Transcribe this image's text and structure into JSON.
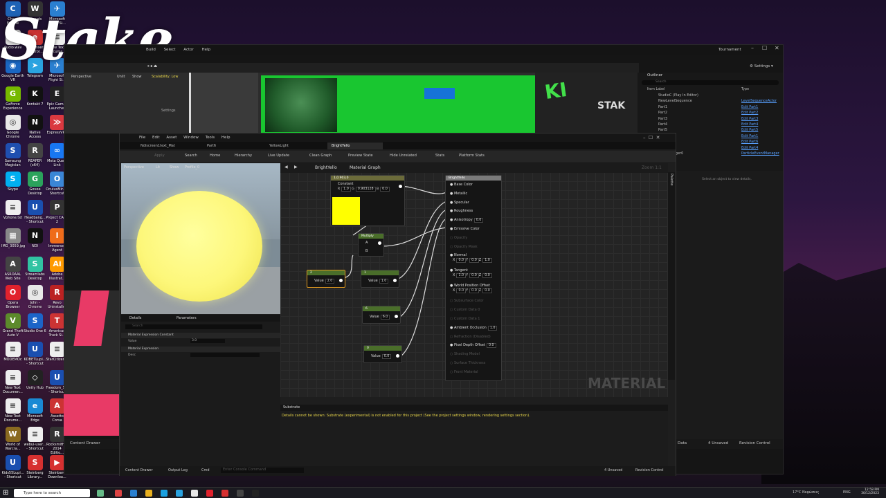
{
  "desktop": {
    "icons": [
      {
        "label": "Cheat Engine",
        "color": "#1e63b5",
        "glyph": "C"
      },
      {
        "label": "Wizards",
        "color": "#333",
        "glyph": "W"
      },
      {
        "label": "Microsoft Flight Si...",
        "color": "#2a7fd0",
        "glyph": "✈"
      },
      {
        "label": "Audio.wav",
        "color": "#ddd",
        "glyph": "▶"
      },
      {
        "label": "eLicenser Control...",
        "color": "#c33",
        "glyph": "e"
      },
      {
        "label": "New Text Docume...",
        "color": "#eee",
        "glyph": "≡"
      },
      {
        "label": "Google Earth VR",
        "color": "#1a66c2",
        "glyph": "◉"
      },
      {
        "label": "Telegram",
        "color": "#2aa3e0",
        "glyph": "➤"
      },
      {
        "label": "Microsoft Flight Si...",
        "color": "#2a7fd0",
        "glyph": "✈"
      },
      {
        "label": "GeForce Experience",
        "color": "#76b900",
        "glyph": "G"
      },
      {
        "label": "Kontakt 7",
        "color": "#111",
        "glyph": "K"
      },
      {
        "label": "Epic Games Launcher",
        "color": "#222",
        "glyph": "E"
      },
      {
        "label": "Google Chrome",
        "color": "#e8e8e8",
        "glyph": "◎"
      },
      {
        "label": "Native Access",
        "color": "#111",
        "glyph": "N"
      },
      {
        "label": "ExpressVPN",
        "color": "#da3940",
        "glyph": "≫"
      },
      {
        "label": "Samsung Magician",
        "color": "#1f4fb0",
        "glyph": "S"
      },
      {
        "label": "REAPER (x64)",
        "color": "#444",
        "glyph": "R"
      },
      {
        "label": "Meta Quest Link",
        "color": "#1877f2",
        "glyph": "∞"
      },
      {
        "label": "Skype",
        "color": "#00aff0",
        "glyph": "S"
      },
      {
        "label": "Govee Desktop",
        "color": "#2ba35c",
        "glyph": "G"
      },
      {
        "label": "OculusMir... - Shortcut",
        "color": "#3a86d6",
        "glyph": "O"
      },
      {
        "label": "Vphone.txt",
        "color": "#eee",
        "glyph": "≡"
      },
      {
        "label": "Headbang... - Shortcut",
        "color": "#1a4fb0",
        "glyph": "U"
      },
      {
        "label": "Project CARS 2",
        "color": "#333",
        "glyph": "P"
      },
      {
        "label": "IMG_3059.jpg",
        "color": "#888",
        "glyph": "▦"
      },
      {
        "label": "NDI",
        "color": "#111",
        "glyph": "N"
      },
      {
        "label": "Immersed Agent",
        "color": "#ef6c1a",
        "glyph": "I"
      },
      {
        "label": "ASROAAL Web Site",
        "color": "#444",
        "glyph": "A"
      },
      {
        "label": "Streamlabs Desktop",
        "color": "#31c3a2",
        "glyph": "S"
      },
      {
        "label": "Adobe Illustrat...",
        "color": "#ff9a00",
        "glyph": "Ai"
      },
      {
        "label": "Opera Browser",
        "color": "#e1222d",
        "glyph": "O"
      },
      {
        "label": "John - Chrome",
        "color": "#e8e8e8",
        "glyph": "◎"
      },
      {
        "label": "Revo Uninstaller",
        "color": "#b22",
        "glyph": "R"
      },
      {
        "label": "Grand Theft Auto V",
        "color": "#5c8a2b",
        "glyph": "V"
      },
      {
        "label": "Studio One 6",
        "color": "#1c64c8",
        "glyph": "S"
      },
      {
        "label": "American Truck Si...",
        "color": "#c33",
        "glyph": "T"
      },
      {
        "label": "MODEMOc",
        "color": "#eee",
        "glyph": "≡"
      },
      {
        "label": "KDBETLupi... - Shortcut",
        "color": "#1a4fb0",
        "glyph": "U"
      },
      {
        "label": "StarCitizen...",
        "color": "#eee",
        "glyph": "≡"
      },
      {
        "label": "New Text Documen...",
        "color": "#eee",
        "glyph": "≡"
      },
      {
        "label": "Unity Hub",
        "color": "#222",
        "glyph": "◇"
      },
      {
        "label": "Freedom_S... - Shortcut",
        "color": "#1a4fb0",
        "glyph": "U"
      },
      {
        "label": "New Text Docume...",
        "color": "#eee",
        "glyph": "≡"
      },
      {
        "label": "Microsoft Edge",
        "color": "#1a8ad4",
        "glyph": "e"
      },
      {
        "label": "Assetto Corsa",
        "color": "#c33",
        "glyph": "A"
      },
      {
        "label": "World of Warcra...",
        "color": "#8a6a20",
        "glyph": "W"
      },
      {
        "label": "webui-user... - Shortcut",
        "color": "#eee",
        "glyph": "≡"
      },
      {
        "label": "Rocksmith® 2014 Editio...",
        "color": "#333",
        "glyph": "R"
      },
      {
        "label": "Kids55Lupi... - Shortcut",
        "color": "#1a4fb0",
        "glyph": "U"
      },
      {
        "label": "Steinberg Library...",
        "color": "#d63030",
        "glyph": "S"
      },
      {
        "label": "Steinberg Downloa...",
        "color": "#d63030",
        "glyph": "▶"
      }
    ],
    "logo_text": "Stake"
  },
  "unreal": {
    "menu": [
      "Build",
      "Select",
      "Actor",
      "Help"
    ],
    "window_title": "Tournament",
    "settings_label": "Settings",
    "viewport": {
      "mode": "Perspective",
      "lit": "Unlit",
      "show": "Show",
      "scalability": "Scalability: Low",
      "settings": "Settings"
    },
    "outliner": {
      "title": "Outliner",
      "search": "Search",
      "col_label": "Item Label",
      "col_type": "Type",
      "rows": [
        {
          "label": "StudioC (Play In Editor)",
          "type": ""
        },
        {
          "label": "NewLevelSequence",
          "type": "LevelSequenceActor"
        },
        {
          "label": "Part1",
          "type": "Edit Part1"
        },
        {
          "label": "Part2",
          "type": "Edit Part2"
        },
        {
          "label": "Part3",
          "type": "Edit Part3"
        },
        {
          "label": "Part4",
          "type": "Edit Part4"
        },
        {
          "label": "Part5",
          "type": "Edit Part5"
        },
        {
          "label": "Part1",
          "type": "Edit Part1"
        },
        {
          "label": "Part6",
          "type": "Edit Part6"
        },
        {
          "label": "Part4",
          "type": "Edit Part4"
        },
        {
          "label": "ventManager0",
          "type": "ParticleEventManager"
        }
      ]
    },
    "details_empty": "Select an object to view details.",
    "bottom": {
      "content_drawer": "Content Drawer",
      "output_log": "Output Log",
      "cmd": "Cmd",
      "console_placeholder": "Enter Console Command",
      "unsaved": "4 Unsaved",
      "revision": "Revision Control",
      "data": "Data"
    }
  },
  "material_editor": {
    "menu": [
      "File",
      "Edit",
      "Asset",
      "Window",
      "Tools",
      "Help"
    ],
    "tabs": [
      "Ndiscreen1text_Mat",
      "Part6",
      "YellowLight",
      "BrightYello"
    ],
    "toolbar": [
      "Apply",
      "Search",
      "Home",
      "Hierarchy",
      "Live Update",
      "Clean Graph",
      "Preview State",
      "Hide Unrelated",
      "Stats",
      "Platform Stats"
    ],
    "preview_bar": {
      "perspective": "Perspective",
      "lit": "Lit",
      "show": "Show",
      "profile": "Profile_0"
    },
    "details": {
      "tab_details": "Details",
      "tab_params": "Parameters",
      "search": "Search",
      "section1": "Material Expression Constant",
      "value_label": "Value",
      "value": "3.0",
      "section2": "Material Expression",
      "desc_label": "Desc"
    },
    "breadcrumb": {
      "asset": "BrightYello",
      "graph": "Material Graph"
    },
    "zoom": "Zoom 1:1",
    "palette": "Palette",
    "watermark": "MATERIAL",
    "nodes": {
      "constant3": {
        "header": "1,0.903,0",
        "title": "Constant",
        "r": "1.0",
        "g": "0.903128",
        "b": "0.0",
        "swatch": "#ffff00"
      },
      "multiply": {
        "title": "Multiply",
        "a": "A",
        "b": "B"
      },
      "c2": {
        "header": "2",
        "value_label": "Value",
        "value": "2.0"
      },
      "c1": {
        "header": "1",
        "value_label": "Value",
        "value": "1.0"
      },
      "c6": {
        "header": "6",
        "value_label": "Value",
        "value": "6.0"
      },
      "c0": {
        "header": "0",
        "value_label": "Value",
        "value": "0.0"
      }
    },
    "result": {
      "title": "BrightYello",
      "pins": [
        {
          "label": "Base Color",
          "dim": false
        },
        {
          "label": "Metallic",
          "dim": false
        },
        {
          "label": "Specular",
          "dim": false
        },
        {
          "label": "Roughness",
          "dim": false
        },
        {
          "label": "Anisotropy",
          "dim": false,
          "value": "0.0"
        },
        {
          "label": "Emissive Color",
          "dim": false
        },
        {
          "label": "Opacity",
          "dim": true
        },
        {
          "label": "Opacity Mask",
          "dim": true
        },
        {
          "label": "Normal",
          "dim": false,
          "vec": [
            "0.0",
            "0.0",
            "1.0"
          ]
        },
        {
          "label": "Tangent",
          "dim": false,
          "vec": [
            "1.0",
            "0.0",
            "0.0"
          ]
        },
        {
          "label": "World Position Offset",
          "dim": false,
          "vec": [
            "0.0",
            "0.0",
            "0.0"
          ]
        },
        {
          "label": "Subsurface Color",
          "dim": true
        },
        {
          "label": "Custom Data 0",
          "dim": true
        },
        {
          "label": "Custom Data 1",
          "dim": true
        },
        {
          "label": "Ambient Occlusion",
          "dim": false,
          "value": "1.0"
        },
        {
          "label": "Refraction (Disabled)",
          "dim": true
        },
        {
          "label": "Pixel Depth Offset",
          "dim": false,
          "value": "0.0"
        },
        {
          "label": "Shading Model",
          "dim": true
        },
        {
          "label": "Surface Thickness",
          "dim": true
        },
        {
          "label": "Front Material",
          "dim": true
        }
      ]
    },
    "substrate": {
      "tab": "Substrate",
      "message": "Details cannot be shown: Substrate (experimental) is not enabled for this project (See the project settings window, rendering settings section)."
    },
    "bottom": {
      "content_drawer": "Content Drawer",
      "output_log": "Output Log",
      "cmd": "Cmd",
      "console_placeholder": "Enter Console Command",
      "unsaved": "4 Unsaved",
      "revision": "Revision Control"
    }
  },
  "taskbar": {
    "search_placeholder": "Type here to search",
    "weather": "17°C  Νεφώσεις",
    "lang": "ENG",
    "time": "12:58 PM",
    "date": "30/12/2023"
  }
}
